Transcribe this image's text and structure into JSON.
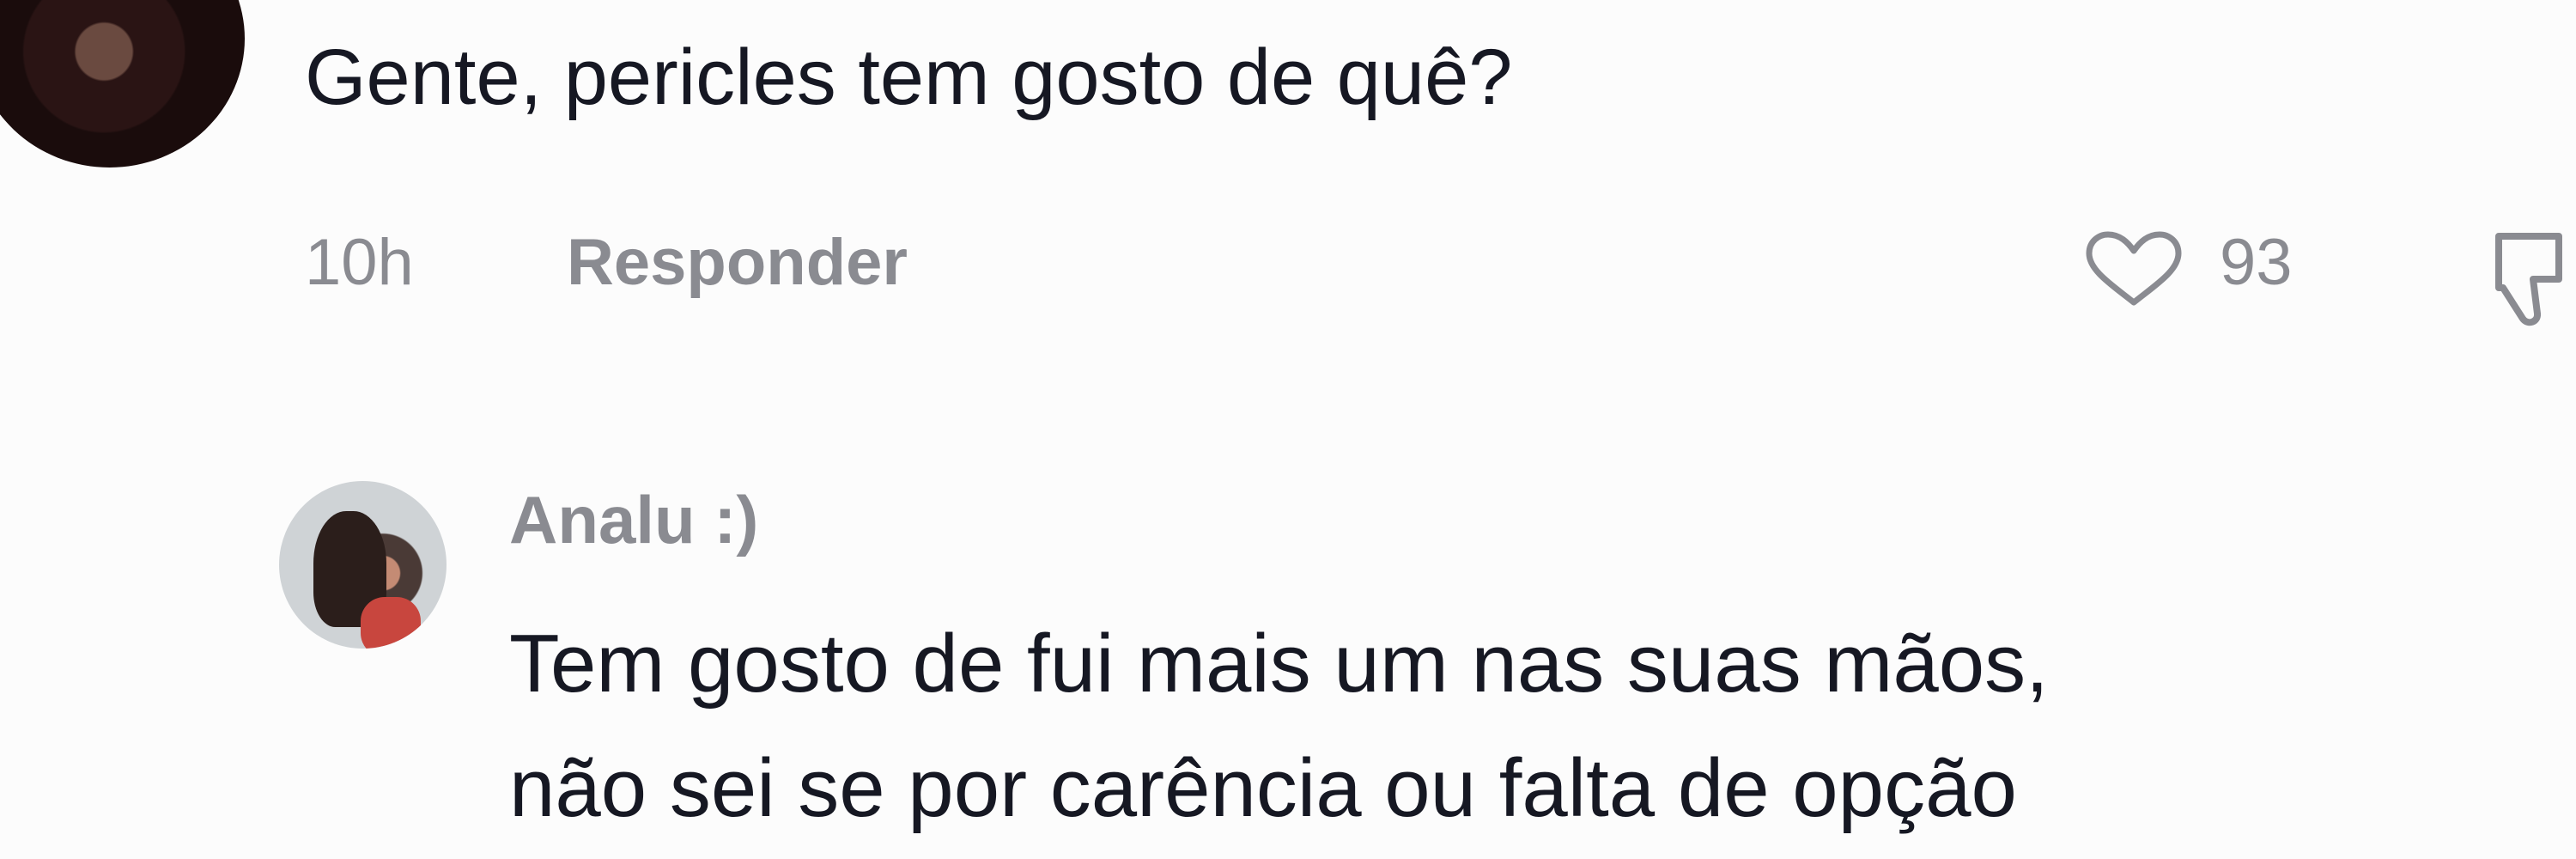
{
  "comment": {
    "text": "Gente, pericles tem gosto de quê?",
    "time": "10h",
    "reply_label": "Responder",
    "like_count": "93",
    "like_icon": "heart-icon",
    "dislike_icon": "thumbs-down-icon"
  },
  "reply": {
    "author": "Analu :)",
    "lines": [
      "Tem gosto de fui mais um nas suas mãos,",
      "não sei se por carência ou falta de opção"
    ]
  }
}
